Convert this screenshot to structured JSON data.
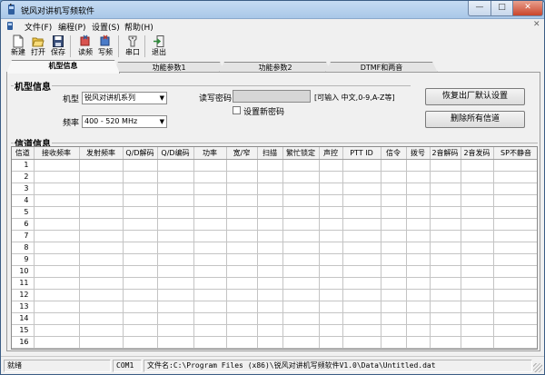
{
  "window": {
    "title": "锐风对讲机写频软件",
    "min": "—",
    "max": "□",
    "close": "✕"
  },
  "menu": [
    {
      "label": "文件(F)"
    },
    {
      "label": "编程(P)"
    },
    {
      "label": "设置(S)"
    },
    {
      "label": "帮助(H)"
    }
  ],
  "menu_close": "✕",
  "toolbar": [
    {
      "label": "新建",
      "icon": "new-file-icon"
    },
    {
      "label": "打开",
      "icon": "open-folder-icon"
    },
    {
      "label": "保存",
      "icon": "save-disk-icon"
    },
    {
      "label": "读频",
      "icon": "read-freq-icon"
    },
    {
      "label": "写频",
      "icon": "write-freq-icon"
    },
    {
      "label": "串口",
      "icon": "serial-port-icon"
    },
    {
      "label": "退出",
      "icon": "exit-icon"
    }
  ],
  "tabs": [
    {
      "label": "机型信息"
    },
    {
      "label": "功能参数1"
    },
    {
      "label": "功能参数2"
    },
    {
      "label": "DTMF和两音"
    }
  ],
  "model_info": {
    "group_title": "机型信息",
    "model_label": "机型",
    "model_value": "锐风对讲机系列",
    "freq_label": "频率",
    "freq_value": "400 - 520 MHz",
    "password_label": "读写密码",
    "password_value": "",
    "password_hint": "[可输入 中文,0-9,A-Z等]",
    "set_password_label": "设置新密码",
    "restore_button": "恢复出厂默认设置",
    "delete_button": "删除所有信道"
  },
  "channels": {
    "group_title": "信道信息",
    "columns": [
      "信道",
      "接收频率",
      "发射频率",
      "Q/D解码",
      "Q/D编码",
      "功率",
      "宽/窄",
      "扫描",
      "繁忙锁定",
      "声控",
      "PTT ID",
      "信令",
      "拨号",
      "2音解码",
      "2音发码",
      "SP不静音"
    ],
    "rows": [
      "1",
      "2",
      "3",
      "4",
      "5",
      "6",
      "7",
      "8",
      "9",
      "10",
      "11",
      "12",
      "13",
      "14",
      "15",
      "16"
    ]
  },
  "status": {
    "state": "就绪",
    "port": "COM1",
    "file": "文件名:C:\\Program Files (x86)\\锐风对讲机写频软件V1.0\\Data\\Untitled.dat"
  }
}
